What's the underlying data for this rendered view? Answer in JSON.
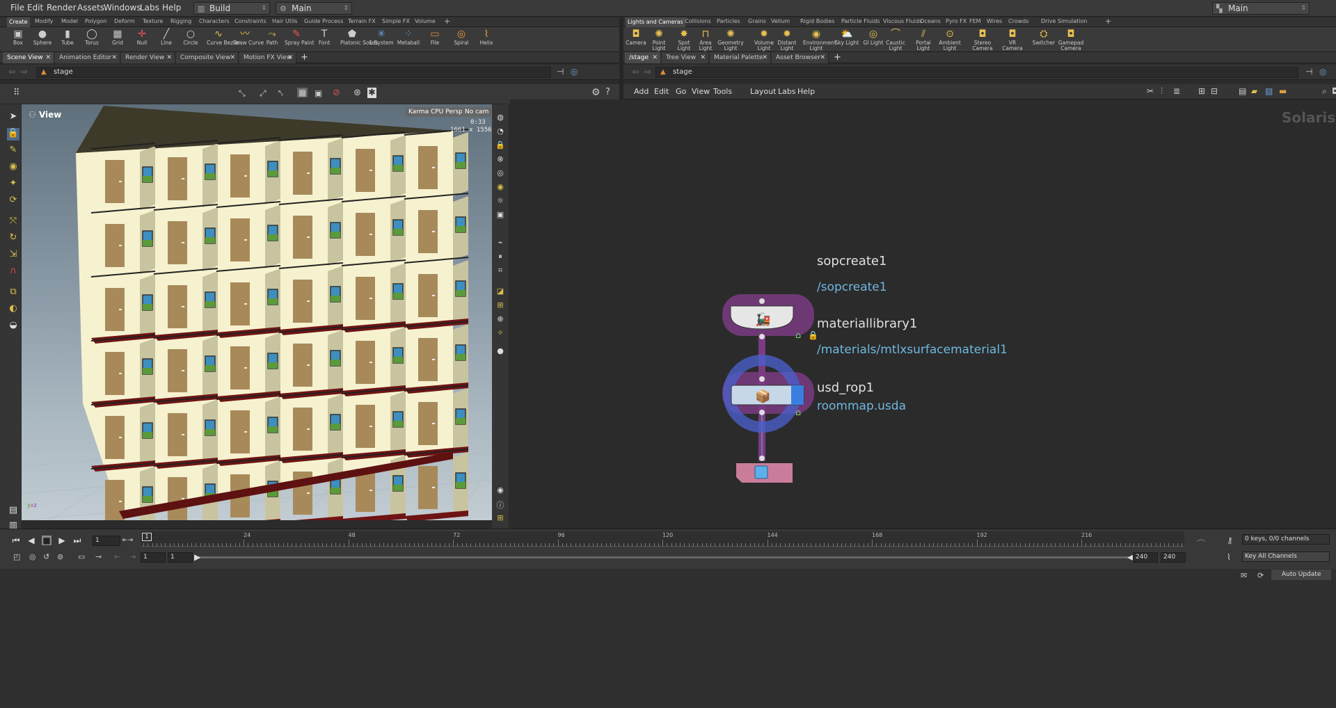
{
  "menubar": {
    "items": [
      "File",
      "Edit",
      "Render",
      "Assets",
      "Windows",
      "Labs",
      "Help"
    ],
    "desktop": "Build",
    "context": "Main",
    "right_context": "Main"
  },
  "left_shelf": {
    "tabs": [
      "Create",
      "Modify",
      "Model",
      "Polygon",
      "Deform",
      "Texture",
      "Rigging",
      "Characters",
      "Constraints",
      "Hair Utils",
      "Guide Process",
      "Terrain FX",
      "Simple FX",
      "Volume"
    ],
    "active_tab": "Create",
    "tools": [
      "Box",
      "Sphere",
      "Tube",
      "Torus",
      "Grid",
      "Null",
      "Line",
      "Circle",
      "Curve Bezier",
      "Draw Curve",
      "Path",
      "Spray Paint",
      "Font",
      "Platonic Solids",
      "L-System",
      "Metaball",
      "File",
      "Spiral",
      "Helix"
    ]
  },
  "right_shelf": {
    "tabs": [
      "Lights and Cameras",
      "Collisions",
      "Particles",
      "Grains",
      "Vellum",
      "Rigid Bodies",
      "Particle Fluids",
      "Viscous Fluids",
      "Oceans",
      "Pyro FX",
      "FEM",
      "Wires",
      "Crowds",
      "Drive Simulation"
    ],
    "active_tab": "Lights and Cameras",
    "tools": [
      "Camera",
      "Point Light",
      "Spot Light",
      "Area Light",
      "Geometry Light",
      "Volume Light",
      "Distant Light",
      "Environment Light",
      "Sky Light",
      "GI Light",
      "Caustic Light",
      "Portal Light",
      "Ambient Light",
      "Stereo Camera",
      "VR Camera",
      "Switcher",
      "Gamepad Camera"
    ]
  },
  "left_pane": {
    "tabs": [
      "Scene View",
      "Animation Editor",
      "Render View",
      "Composite View",
      "Motion FX View"
    ],
    "path": "stage",
    "viewport_label": "View",
    "renderer_button": "Karma CPU  Persp",
    "camera_button": "No cam",
    "time_readout": "0:33",
    "resolution_readout": "1661 x 1556"
  },
  "right_pane": {
    "tabs": [
      "/stage",
      "Tree View",
      "Material Palette",
      "Asset Browser"
    ],
    "path": "stage",
    "menu": [
      "Add",
      "Edit",
      "Go",
      "View",
      "Tools",
      "Layout",
      "Labs",
      "Help"
    ],
    "network_label": "Solaris",
    "nodes": [
      {
        "name": "sopcreate1",
        "sub": "/sopcreate1",
        "color": "#7a3b82"
      },
      {
        "name": "materiallibrary1",
        "sub": "/materials/mtlxsurfacematerial1",
        "color": "#7a3b82"
      },
      {
        "name": "usd_rop1",
        "sub": "roommap.usda",
        "color": "#c97d9b"
      }
    ]
  },
  "timeline": {
    "current_frame": "1",
    "ticks": [
      "24",
      "48",
      "72",
      "96",
      "120",
      "144",
      "168",
      "192",
      "216"
    ],
    "range_start": "1",
    "range_start2": "1",
    "range_end": "240",
    "range_end2": "240",
    "channels_readout": "0 keys, 0/0 channels",
    "key_button": "Key All Channels",
    "update_button": "Auto Update"
  },
  "colors": {
    "accent": "#d9c04a",
    "node_purple": "#7a3b82",
    "link_blue": "#6fb8e0"
  }
}
